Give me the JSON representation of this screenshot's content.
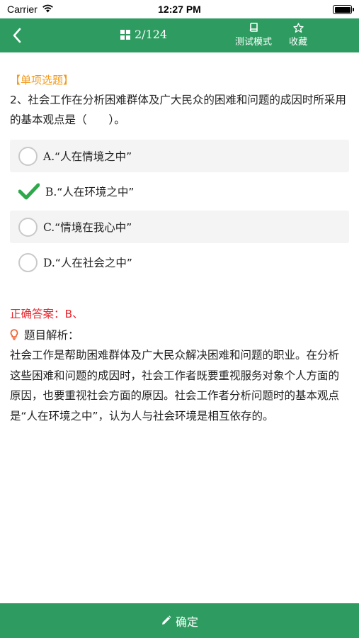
{
  "status_bar": {
    "carrier": "Carrier",
    "time": "12:27 PM"
  },
  "nav": {
    "progress": "2/124",
    "mode_label": "测试模式",
    "favorite_label": "收藏"
  },
  "question": {
    "type": "【单项选题】",
    "stem": "2、社会工作在分析困难群体及广大民众的困难和问题的成因时所采用的基本观点是（　　）。",
    "options": [
      {
        "letter": "A.",
        "text": "“人在情境之中”",
        "state": "unselected"
      },
      {
        "letter": "B.",
        "text": "“人在环境之中”",
        "state": "correct"
      },
      {
        "letter": "C.",
        "text": "“情境在我心中”",
        "state": "unselected"
      },
      {
        "letter": "D.",
        "text": "“人在社会之中”",
        "state": "unselected"
      }
    ]
  },
  "result": {
    "answer": "正确答案：B、",
    "analysis_title": "题目解析：",
    "analysis_body": "社会工作是帮助困难群体及广大民众解决困难和问题的职业。在分析这些困难和问题的成因时，社会工作者既要重视服务对象个人方面的原因，也要重视社会方面的原因。社会工作者分析问题时的基本观点是“人在环境之中”，认为人与社会环境是相互依存的。"
  },
  "bottom": {
    "confirm_label": "确定"
  },
  "colors": {
    "primary": "#2e9c61",
    "accent_orange": "#f39a1b",
    "answer_red": "#e8262d",
    "check_green": "#2ea84a"
  },
  "icons": [
    "wifi-icon",
    "battery-icon",
    "back-icon",
    "grid-icon",
    "book-icon",
    "star-icon",
    "check-icon",
    "bulb-icon",
    "pencil-icon"
  ]
}
